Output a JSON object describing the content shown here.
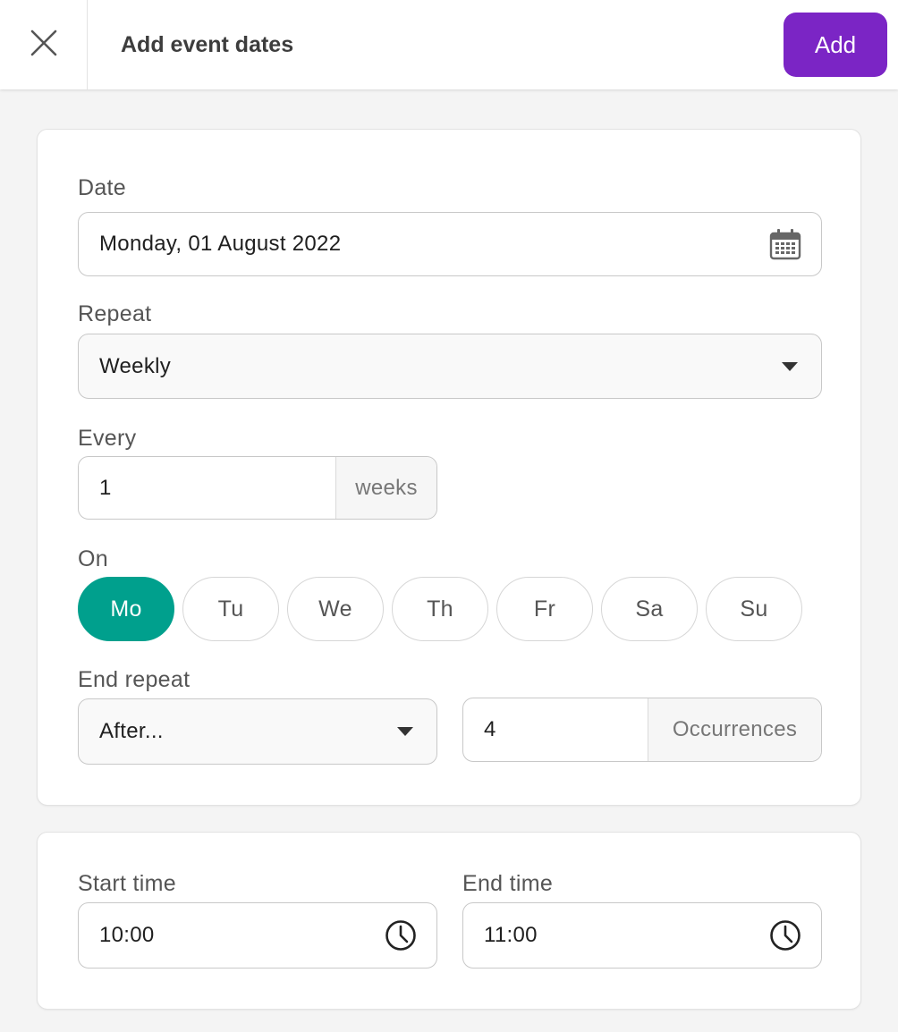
{
  "header": {
    "title": "Add event dates",
    "add_label": "Add"
  },
  "colors": {
    "accent_purple": "#7b25c5",
    "active_day_teal": "#00a08d",
    "background": "#f4f4f4"
  },
  "form": {
    "date": {
      "label": "Date",
      "value": "Monday, 01 August 2022",
      "icon": "calendar-icon"
    },
    "repeat": {
      "label": "Repeat",
      "value": "Weekly"
    },
    "every": {
      "label": "Every",
      "value": "1",
      "unit": "weeks"
    },
    "on": {
      "label": "On",
      "days": [
        {
          "label": "Mo",
          "selected": true
        },
        {
          "label": "Tu",
          "selected": false
        },
        {
          "label": "We",
          "selected": false
        },
        {
          "label": "Th",
          "selected": false
        },
        {
          "label": "Fr",
          "selected": false
        },
        {
          "label": "Sa",
          "selected": false
        },
        {
          "label": "Su",
          "selected": false
        }
      ]
    },
    "end_repeat": {
      "label": "End repeat",
      "value": "After...",
      "count": "4",
      "unit": "Occurrences"
    }
  },
  "time": {
    "start": {
      "label": "Start time",
      "value": "10:00",
      "icon": "clock-icon"
    },
    "end": {
      "label": "End time",
      "value": "11:00",
      "icon": "clock-icon"
    }
  }
}
